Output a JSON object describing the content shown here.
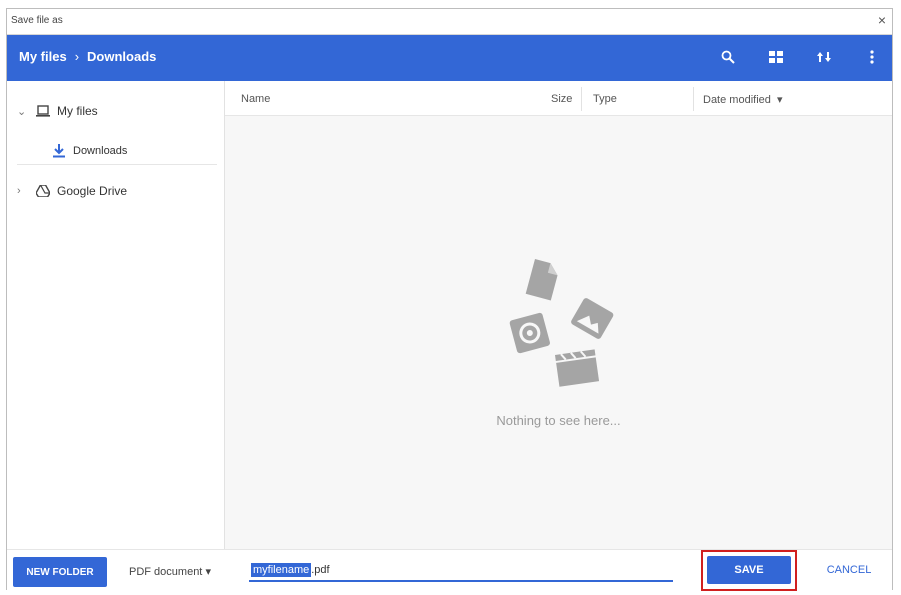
{
  "window": {
    "title": "Save file as",
    "close_icon": "close-icon"
  },
  "breadcrumb": {
    "root": "My files",
    "separator": "›",
    "current": "Downloads"
  },
  "header_icons": [
    "search-icon",
    "grid-view-icon",
    "sort-icon",
    "more-vert-icon"
  ],
  "sidebar": {
    "items": [
      {
        "label": "My files",
        "icon": "laptop-icon",
        "expanded": true
      },
      {
        "label": "Downloads",
        "icon": "download-icon"
      },
      {
        "label": "Google Drive",
        "icon": "drive-icon",
        "expanded": false
      }
    ]
  },
  "columns": {
    "name": "Name",
    "size": "Size",
    "type": "Type",
    "date": "Date modified",
    "date_sort": "▾"
  },
  "empty_state": {
    "message": "Nothing to see here..."
  },
  "footer": {
    "new_folder": "NEW FOLDER",
    "file_type": "PDF document",
    "file_type_arrow": "▾",
    "filename_selected": "myfilename",
    "filename_ext": ".pdf",
    "save": "SAVE",
    "cancel": "CANCEL"
  },
  "colors": {
    "accent": "#3367d6",
    "highlight_box": "#d01f1f"
  }
}
